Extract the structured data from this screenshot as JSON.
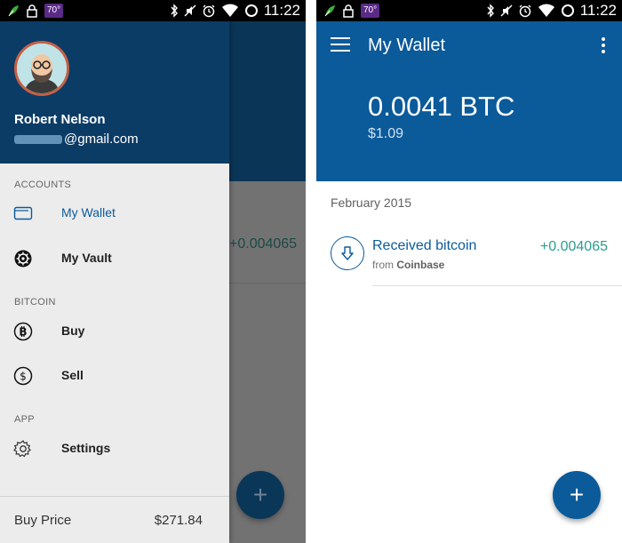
{
  "status_bar": {
    "time": "11:22",
    "temp_badge": "70°",
    "icons_left": [
      "leaf-icon",
      "lock-icon"
    ],
    "icons_right": [
      "bluetooth-icon",
      "mute-icon",
      "alarm-icon",
      "wifi-icon",
      "battery-ring-icon"
    ]
  },
  "drawer": {
    "user": {
      "name": "Robert Nelson",
      "email_visible": "@gmail.com"
    },
    "sections": {
      "accounts": "ACCOUNTS",
      "bitcoin": "BITCOIN",
      "app": "APP"
    },
    "items": [
      {
        "label": "My Wallet",
        "icon": "wallet-icon",
        "active": true
      },
      {
        "label": "My Vault",
        "icon": "vault-icon",
        "active": false
      },
      {
        "label": "Buy",
        "icon": "bitcoin-icon",
        "active": false
      },
      {
        "label": "Sell",
        "icon": "dollar-icon",
        "active": false
      },
      {
        "label": "Settings",
        "icon": "gear-icon",
        "active": false
      }
    ],
    "footer": {
      "label": "Buy Price",
      "value": "$271.84"
    }
  },
  "background_amount": "+0.004065",
  "wallet": {
    "title": "My Wallet",
    "balance_btc": "0.0041 BTC",
    "balance_usd": "$1.09",
    "month": "February 2015",
    "transactions": [
      {
        "title": "Received bitcoin",
        "from_prefix": "from",
        "from_name": "Coinbase",
        "amount": "+0.004065"
      }
    ]
  },
  "fab_label": "+",
  "colors": {
    "primary": "#0b5a9a",
    "drawer_header": "#0b3c66",
    "positive_amount": "#2a9d8f"
  }
}
